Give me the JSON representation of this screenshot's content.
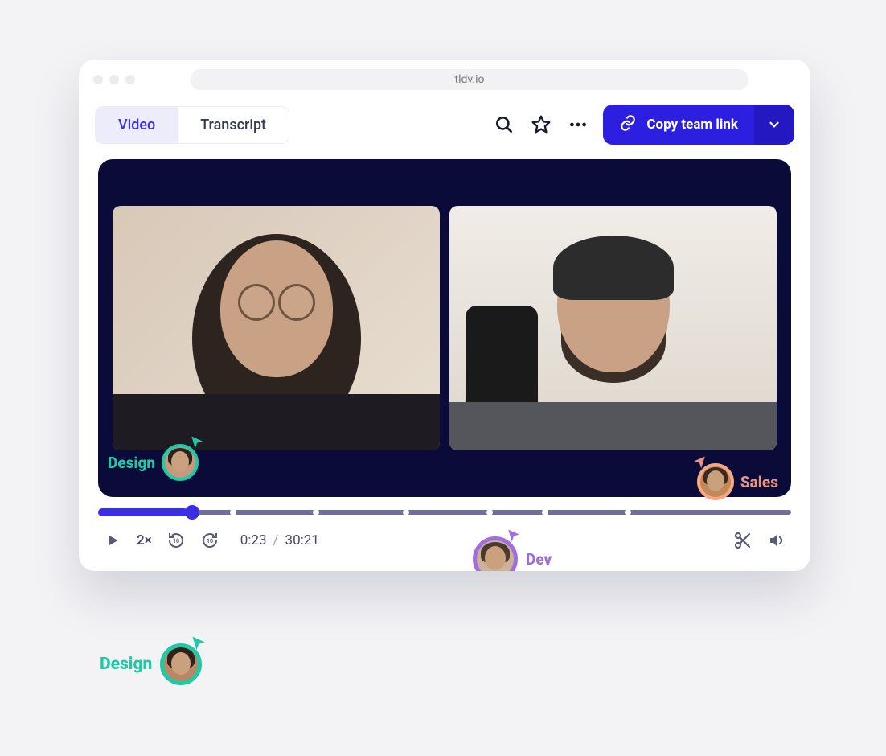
{
  "browser": {
    "url": "tldv.io"
  },
  "tabs": {
    "video": "Video",
    "transcript": "Transcript"
  },
  "cta": {
    "label": "Copy team link"
  },
  "player": {
    "speed": "2×",
    "current_time": "0:23",
    "total_time": "30:21",
    "time_separator": "/",
    "progress_percent": 13,
    "markers_percent": [
      19,
      31,
      44,
      56,
      64,
      76
    ]
  },
  "cursors": {
    "design_video": "Design",
    "sales": "Sales",
    "dev": "Dev",
    "design_external": "Design"
  },
  "colors": {
    "accent": "#2d1fe0",
    "design": "#1fc9a5",
    "sales": "#e39486",
    "dev": "#9c6dd9"
  }
}
